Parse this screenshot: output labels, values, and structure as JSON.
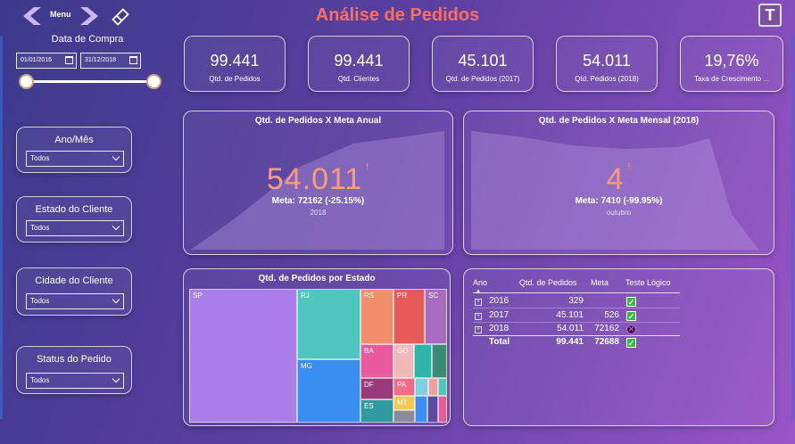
{
  "header": {
    "title": "Análise de Pedidos",
    "menu_label": "Menu",
    "logo_letter": "T"
  },
  "date_slicer": {
    "title": "Data de Compra",
    "start": "01/01/2016",
    "end": "31/12/2018"
  },
  "filters": [
    {
      "title": "Ano/Mês",
      "value": "Todos"
    },
    {
      "title": "Estado do Cliente",
      "value": "Todos"
    },
    {
      "title": "Cidade do Cliente",
      "value": "Todos"
    },
    {
      "title": "Status do Pedido",
      "value": "Todos"
    }
  ],
  "kpis": [
    {
      "value": "99.441",
      "label": "Qtd. de Pedidos"
    },
    {
      "value": "99.441",
      "label": "Qtd. Clientes"
    },
    {
      "value": "45.101",
      "label": "Qtd. de Pedidos (2017)"
    },
    {
      "value": "54.011",
      "label": "Qtd. Pedidos (2018)"
    },
    {
      "value": "19,76%",
      "label": "Taxa de Crescimento ..."
    }
  ],
  "gauge_annual": {
    "title": "Qtd. de Pedidos X Meta Anual",
    "value": "54.011",
    "marker": "!",
    "meta": "Meta: 72162 (-25.15%)",
    "sub": "2018"
  },
  "gauge_monthly": {
    "title": "Qtd. de Pedidos X Meta Mensal (2018)",
    "value": "4",
    "marker": "!",
    "meta": "Meta: 7410 (-99.95%)",
    "sub": "outubro"
  },
  "treemap": {
    "title": "Qtd. de Pedidos por Estado",
    "cells": [
      {
        "label": "SP",
        "color": "#a97ee8"
      },
      {
        "label": "RJ",
        "color": "#4fc6bd"
      },
      {
        "label": "MG",
        "color": "#3a8ef0"
      },
      {
        "label": "RS",
        "color": "#f08f6a"
      },
      {
        "label": "PR",
        "color": "#e85a5a"
      },
      {
        "label": "SC",
        "color": "#a86bc0"
      },
      {
        "label": "BA",
        "color": "#e85a9b"
      },
      {
        "label": "GO",
        "color": "#f0b8b8"
      },
      {
        "label": "DF",
        "color": "#9a3a7a"
      },
      {
        "label": "PA",
        "color": "#f46a8a"
      },
      {
        "label": "ES",
        "color": "#2f9aa0"
      },
      {
        "label": "MT",
        "color": "#f2c84e"
      }
    ]
  },
  "table": {
    "headers": [
      "Ano",
      "Qtd. de Pedidos",
      "Meta",
      "Teste Lógico"
    ],
    "rows": [
      {
        "year": "2016",
        "orders": "329",
        "meta": "",
        "status": "ok"
      },
      {
        "year": "2017",
        "orders": "45.101",
        "meta": "526",
        "status": "ok"
      },
      {
        "year": "2018",
        "orders": "54.011",
        "meta": "72162",
        "status": "fail"
      }
    ],
    "total": {
      "label": "Total",
      "orders": "99.441",
      "meta": "72688",
      "status": "ok"
    }
  },
  "colors": {
    "title": "#ff6f61",
    "gauge_value": "#ff9a7a",
    "check_ok": "#2fbe3a"
  }
}
